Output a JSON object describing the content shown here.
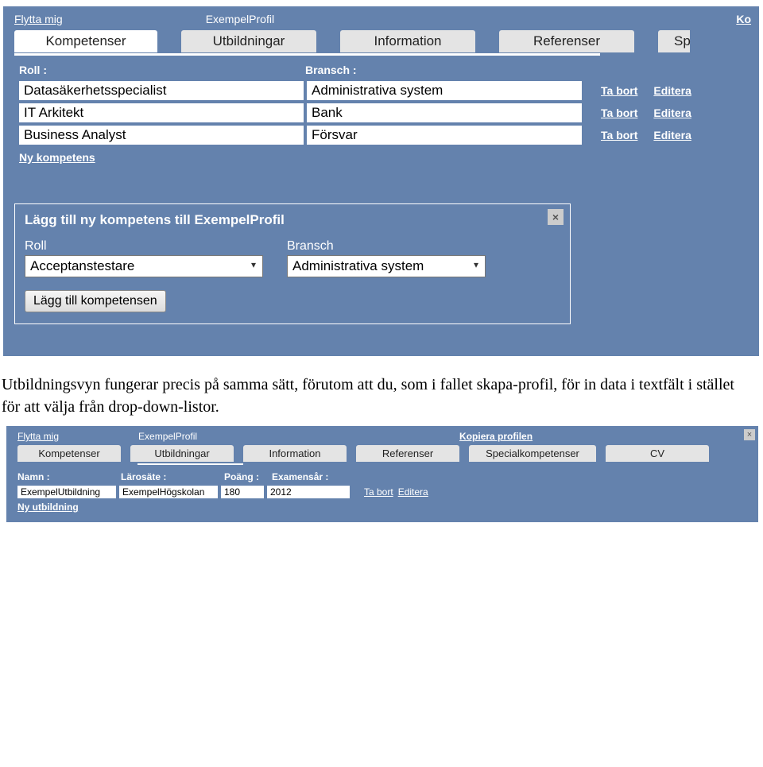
{
  "panel1": {
    "topnav": {
      "move_link": "Flytta mig",
      "profile_name": "ExempelProfil",
      "right_link": "Ko"
    },
    "tabs": [
      {
        "label": "Kompetenser",
        "active": true
      },
      {
        "label": "Utbildningar",
        "active": false
      },
      {
        "label": "Information",
        "active": false
      },
      {
        "label": "Referenser",
        "active": false
      },
      {
        "label": "Sp",
        "active": false
      }
    ],
    "headers": {
      "roll": "Roll :",
      "bransch": "Bransch :"
    },
    "rows": [
      {
        "roll": "Datasäkerhetsspecialist",
        "bransch": "Administrativa system"
      },
      {
        "roll": "IT Arkitekt",
        "bransch": "Bank"
      },
      {
        "roll": "Business Analyst",
        "bransch": "Försvar"
      }
    ],
    "row_actions": {
      "remove": "Ta bort",
      "edit": "Editera"
    },
    "new_link": "Ny kompetens",
    "modal": {
      "title": "Lägg till ny kompetens till ExempelProfil",
      "roll_label": "Roll",
      "roll_value": "Acceptanstestare",
      "bransch_label": "Bransch",
      "bransch_value": "Administrativa system",
      "button": "Lägg till kompetensen",
      "close": "×"
    }
  },
  "description": "Utbildningsvyn fungerar precis på samma sätt, förutom att du, som i fallet skapa-profil, för in data i textfält i stället för att välja från drop-down-listor.",
  "panel2": {
    "topnav": {
      "move_link": "Flytta mig",
      "profile_name": "ExempelProfil",
      "copy_link": "Kopiera profilen",
      "close": "×"
    },
    "tabs": [
      {
        "label": "Kompetenser",
        "active": false
      },
      {
        "label": "Utbildningar",
        "active": true
      },
      {
        "label": "Information",
        "active": false
      },
      {
        "label": "Referenser",
        "active": false
      },
      {
        "label": "Specialkompetenser",
        "active": false
      },
      {
        "label": "CV",
        "active": false
      }
    ],
    "headers": {
      "namn": "Namn :",
      "larosate": "Lärosäte :",
      "poang": "Poäng :",
      "examensar": "Examensår :"
    },
    "rows": [
      {
        "namn": "ExempelUtbildning",
        "larosate": "ExempelHögskolan",
        "poang": "180",
        "examensar": "2012"
      }
    ],
    "row_actions": {
      "remove": "Ta bort",
      "edit": "Editera"
    },
    "new_link": "Ny utbildning"
  }
}
